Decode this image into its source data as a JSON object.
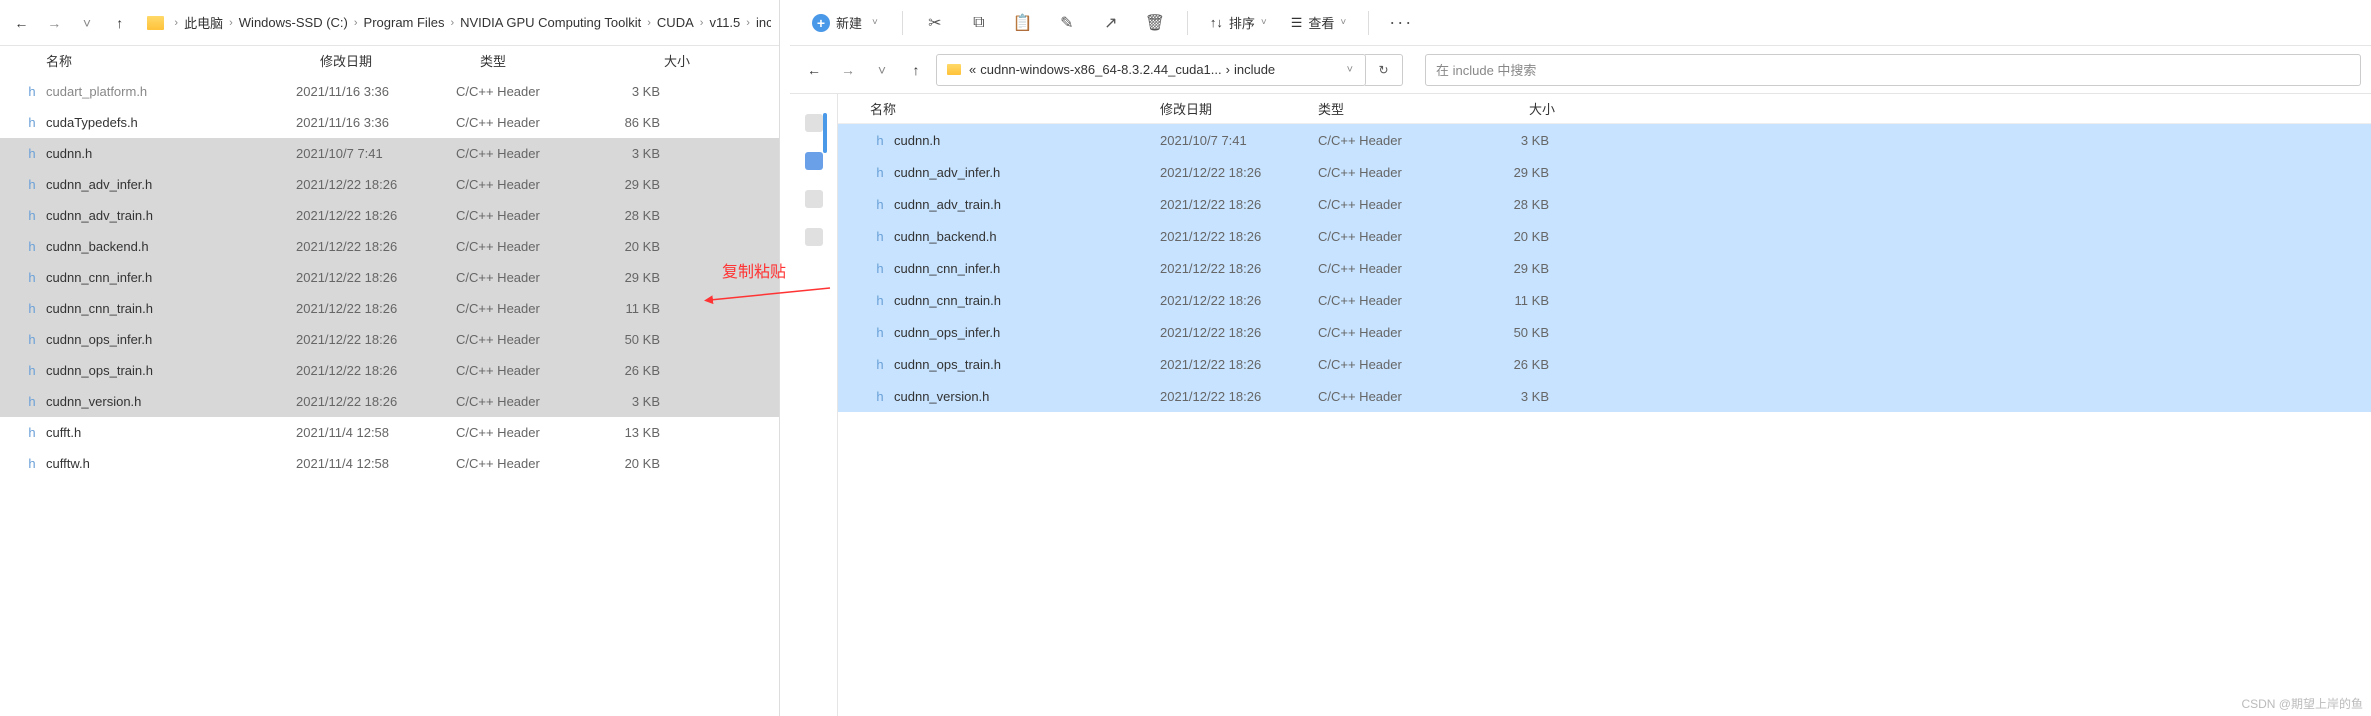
{
  "left": {
    "breadcrumb": [
      "此电脑",
      "Windows-SSD (C:)",
      "Program Files",
      "NVIDIA GPU Computing Toolkit",
      "CUDA",
      "v11.5",
      "include"
    ],
    "columns": {
      "name": "名称",
      "date": "修改日期",
      "type": "类型",
      "size": "大小"
    },
    "files": [
      {
        "name": "cudart_platform.h",
        "date": "2021/11/16 3:36",
        "type": "C/C++ Header",
        "size": "3 KB",
        "selected": false,
        "cutTop": true
      },
      {
        "name": "cudaTypedefs.h",
        "date": "2021/11/16 3:36",
        "type": "C/C++ Header",
        "size": "86 KB",
        "selected": false
      },
      {
        "name": "cudnn.h",
        "date": "2021/10/7 7:41",
        "type": "C/C++ Header",
        "size": "3 KB",
        "selected": true
      },
      {
        "name": "cudnn_adv_infer.h",
        "date": "2021/12/22 18:26",
        "type": "C/C++ Header",
        "size": "29 KB",
        "selected": true
      },
      {
        "name": "cudnn_adv_train.h",
        "date": "2021/12/22 18:26",
        "type": "C/C++ Header",
        "size": "28 KB",
        "selected": true
      },
      {
        "name": "cudnn_backend.h",
        "date": "2021/12/22 18:26",
        "type": "C/C++ Header",
        "size": "20 KB",
        "selected": true
      },
      {
        "name": "cudnn_cnn_infer.h",
        "date": "2021/12/22 18:26",
        "type": "C/C++ Header",
        "size": "29 KB",
        "selected": true
      },
      {
        "name": "cudnn_cnn_train.h",
        "date": "2021/12/22 18:26",
        "type": "C/C++ Header",
        "size": "11 KB",
        "selected": true
      },
      {
        "name": "cudnn_ops_infer.h",
        "date": "2021/12/22 18:26",
        "type": "C/C++ Header",
        "size": "50 KB",
        "selected": true
      },
      {
        "name": "cudnn_ops_train.h",
        "date": "2021/12/22 18:26",
        "type": "C/C++ Header",
        "size": "26 KB",
        "selected": true
      },
      {
        "name": "cudnn_version.h",
        "date": "2021/12/22 18:26",
        "type": "C/C++ Header",
        "size": "3 KB",
        "selected": true
      },
      {
        "name": "cufft.h",
        "date": "2021/11/4 12:58",
        "type": "C/C++ Header",
        "size": "13 KB",
        "selected": false
      },
      {
        "name": "cufftw.h",
        "date": "2021/11/4 12:58",
        "type": "C/C++ Header",
        "size": "20 KB",
        "selected": false
      }
    ]
  },
  "right": {
    "toolbar": {
      "new": "新建",
      "sort": "排序",
      "view": "查看"
    },
    "address": {
      "prefix": "«",
      "path": "cudnn-windows-x86_64-8.3.2.44_cuda1...",
      "current": "include",
      "search_placeholder": "在 include 中搜索"
    },
    "columns": {
      "name": "名称",
      "date": "修改日期",
      "type": "类型",
      "size": "大小"
    },
    "files": [
      {
        "name": "cudnn.h",
        "date": "2021/10/7 7:41",
        "type": "C/C++ Header",
        "size": "3 KB",
        "selected": true
      },
      {
        "name": "cudnn_adv_infer.h",
        "date": "2021/12/22 18:26",
        "type": "C/C++ Header",
        "size": "29 KB",
        "selected": true
      },
      {
        "name": "cudnn_adv_train.h",
        "date": "2021/12/22 18:26",
        "type": "C/C++ Header",
        "size": "28 KB",
        "selected": true
      },
      {
        "name": "cudnn_backend.h",
        "date": "2021/12/22 18:26",
        "type": "C/C++ Header",
        "size": "20 KB",
        "selected": true
      },
      {
        "name": "cudnn_cnn_infer.h",
        "date": "2021/12/22 18:26",
        "type": "C/C++ Header",
        "size": "29 KB",
        "selected": true
      },
      {
        "name": "cudnn_cnn_train.h",
        "date": "2021/12/22 18:26",
        "type": "C/C++ Header",
        "size": "11 KB",
        "selected": true
      },
      {
        "name": "cudnn_ops_infer.h",
        "date": "2021/12/22 18:26",
        "type": "C/C++ Header",
        "size": "50 KB",
        "selected": true
      },
      {
        "name": "cudnn_ops_train.h",
        "date": "2021/12/22 18:26",
        "type": "C/C++ Header",
        "size": "26 KB",
        "selected": true
      },
      {
        "name": "cudnn_version.h",
        "date": "2021/12/22 18:26",
        "type": "C/C++ Header",
        "size": "3 KB",
        "selected": true
      }
    ]
  },
  "annotation": "复制粘贴",
  "watermark": "CSDN @期望上岸的鱼"
}
